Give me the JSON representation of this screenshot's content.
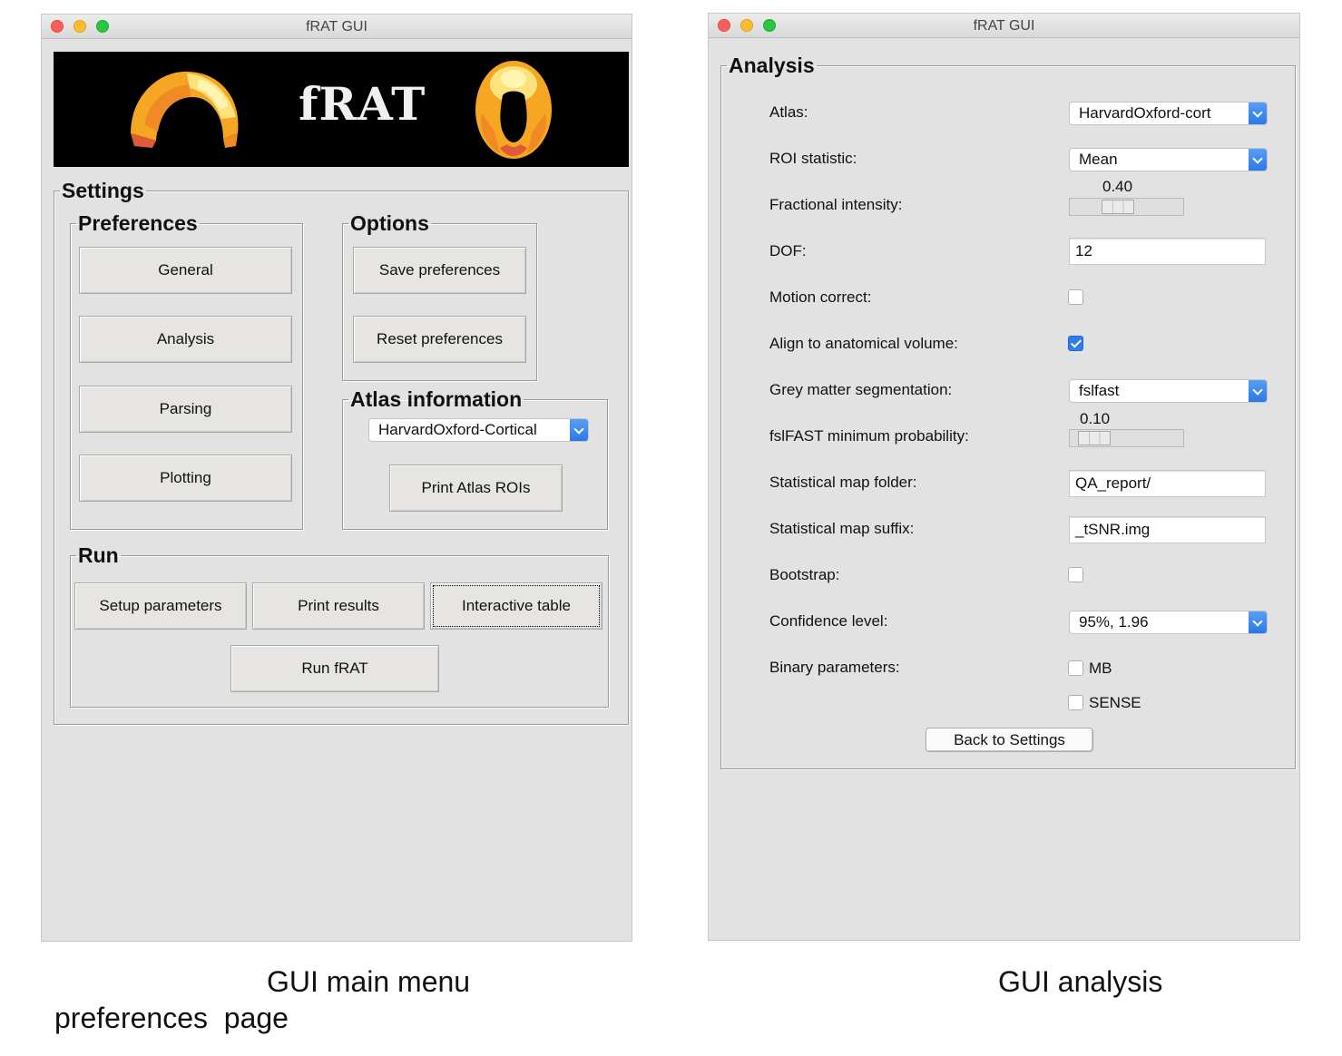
{
  "left_window": {
    "title": "fRAT GUI",
    "banner_title": "fRAT",
    "settings_label": "Settings",
    "preferences": {
      "label": "Preferences",
      "buttons": [
        "General",
        "Analysis",
        "Parsing",
        "Plotting"
      ]
    },
    "options": {
      "label": "Options",
      "save": "Save preferences",
      "reset": "Reset preferences"
    },
    "atlas_info": {
      "label": "Atlas information",
      "selected": "HarvardOxford-Cortical",
      "print_button": "Print Atlas ROIs"
    },
    "run": {
      "label": "Run",
      "setup": "Setup parameters",
      "print_results": "Print results",
      "interactive_table": "Interactive table",
      "run_frat": "Run fRAT"
    }
  },
  "right_window": {
    "title": "fRAT GUI",
    "group_label": "Analysis",
    "atlas_label": "Atlas:",
    "atlas_value": "HarvardOxford-cort",
    "roi_stat_label": "ROI statistic:",
    "roi_stat_value": "Mean",
    "frac_label": "Fractional intensity:",
    "frac_value": "0.40",
    "frac_level": 0.4,
    "dof_label": "DOF:",
    "dof_value": "12",
    "motion_label": "Motion correct:",
    "motion_checked": false,
    "align_label": "Align to anatomical volume:",
    "align_checked": true,
    "grey_label": "Grey matter segmentation:",
    "grey_value": "fslfast",
    "fslfast_label": "fslFAST minimum probability:",
    "fslfast_value": "0.10",
    "fslfast_level": 0.1,
    "map_folder_label": "Statistical map folder:",
    "map_folder_value": "QA_report/",
    "map_suffix_label": "Statistical map suffix:",
    "map_suffix_value": "_tSNR.img",
    "bootstrap_label": "Bootstrap:",
    "bootstrap_checked": false,
    "confidence_label": "Confidence level:",
    "confidence_value": "95%, 1.96",
    "binary_label": "Binary parameters:",
    "binary_mb": "MB",
    "binary_sense": "SENSE",
    "back_button": "Back to Settings"
  },
  "captions": {
    "left_line1": "GUI main menu",
    "left_line2": "preferences  page",
    "right": "GUI analysis"
  },
  "colors": {
    "accent_blue": "#2d7cf0",
    "window_bg": "#e2e2e2",
    "banner_bg": "#000000"
  }
}
